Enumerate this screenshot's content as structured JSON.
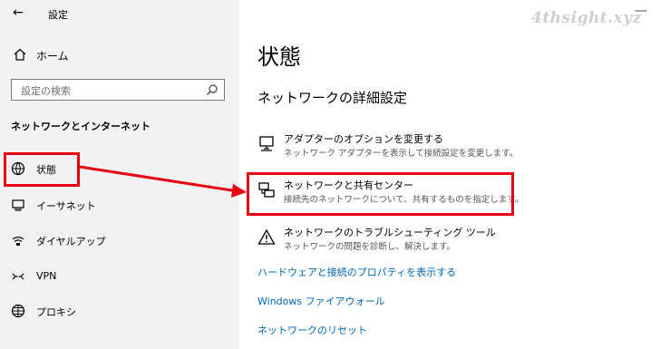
{
  "watermark": "4thsight.xyz",
  "window": {
    "title": "設定",
    "minimize_glyph": "—"
  },
  "sidebar": {
    "home_label": "ホーム",
    "search_placeholder": "設定の検索",
    "section_title": "ネットワークとインターネット",
    "items": [
      {
        "label": "状態",
        "icon": "status-icon"
      },
      {
        "label": "イーサネット",
        "icon": "ethernet-icon"
      },
      {
        "label": "ダイヤルアップ",
        "icon": "dialup-icon"
      },
      {
        "label": "VPN",
        "icon": "vpn-icon"
      },
      {
        "label": "プロキシ",
        "icon": "globe-icon"
      }
    ]
  },
  "main": {
    "title": "状態",
    "subtitle": "ネットワークの詳細設定",
    "settings": [
      {
        "title": "アダプターのオプションを変更する",
        "desc": "ネットワーク アダプターを表示して接続設定を変更します。",
        "icon": "adapter-icon"
      },
      {
        "title": "ネットワークと共有センター",
        "desc": "接続先のネットワークについて、共有するものを指定します。",
        "icon": "sharing-center-icon"
      },
      {
        "title": "ネットワークのトラブルシューティング ツール",
        "desc": "ネットワークの問題を診断し、解決します。",
        "icon": "warning-icon"
      }
    ],
    "links": [
      "ハードウェアと接続のプロパティを表示する",
      "Windows ファイアウォール",
      "ネットワークのリセット"
    ]
  },
  "colors": {
    "highlight": "#e60012",
    "link": "#0067b8",
    "sidebar_bg": "#f2f2f2"
  }
}
